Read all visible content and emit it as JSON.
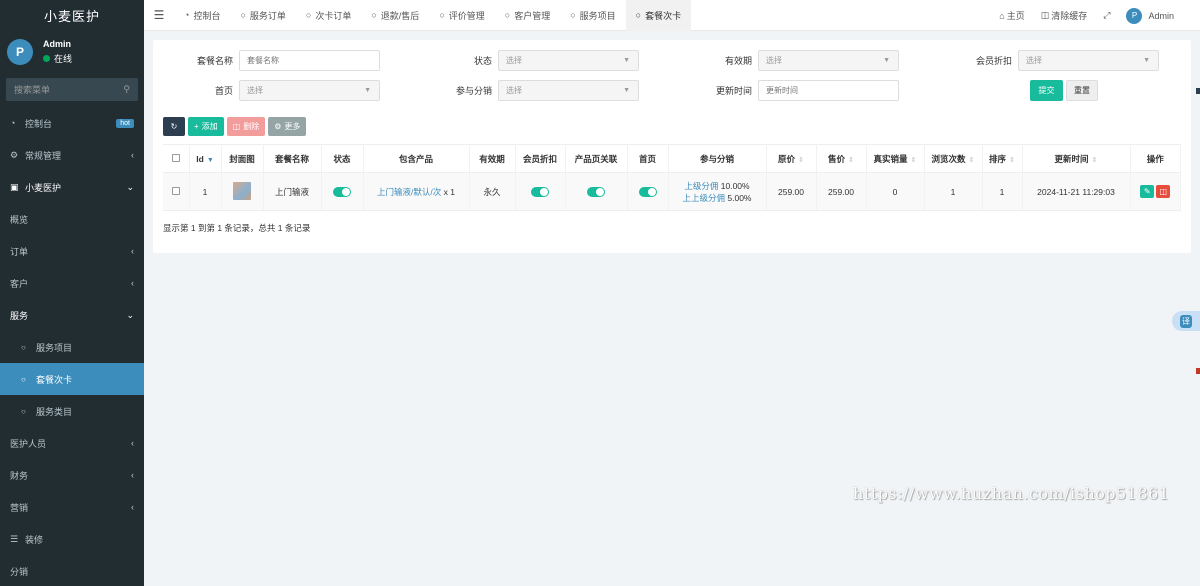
{
  "app": {
    "title": "小麦医护"
  },
  "user": {
    "name": "Admin",
    "status": "在线",
    "avatar_letter": "P"
  },
  "sidebar": {
    "search_placeholder": "搜索菜单",
    "items": [
      {
        "label": "控制台",
        "icon": "dashboard-icon",
        "badge": "hot"
      },
      {
        "label": "常规管理",
        "icon": "cogs-icon"
      },
      {
        "label": "小麦医护",
        "icon": "gamepad-icon",
        "open": true
      },
      {
        "label": "概览"
      },
      {
        "label": "订单"
      },
      {
        "label": "客户"
      },
      {
        "label": "服务",
        "open": true
      },
      {
        "label": "服务项目",
        "sub": true
      },
      {
        "label": "套餐次卡",
        "sub": true,
        "active": true
      },
      {
        "label": "服务类目",
        "sub": true
      },
      {
        "label": "医护人员"
      },
      {
        "label": "财务"
      },
      {
        "label": "营销"
      },
      {
        "label": "装修",
        "icon": "list-icon"
      },
      {
        "label": "分销"
      }
    ]
  },
  "header": {
    "tabs": [
      {
        "label": "控制台",
        "icon": "dashboard-icon"
      },
      {
        "label": "服务订单",
        "icon": "circle-icon"
      },
      {
        "label": "次卡订单",
        "icon": "circle-icon"
      },
      {
        "label": "退款/售后",
        "icon": "circle-icon"
      },
      {
        "label": "评价管理",
        "icon": "circle-icon"
      },
      {
        "label": "客户管理",
        "icon": "circle-icon"
      },
      {
        "label": "服务项目",
        "icon": "circle-icon"
      },
      {
        "label": "套餐次卡",
        "icon": "circle-icon",
        "active": true
      }
    ],
    "home": "主页",
    "clear_cache": "清除缓存",
    "admin": "Admin"
  },
  "filter": {
    "package_name_label": "套餐名称",
    "package_name_placeholder": "套餐名称",
    "status_label": "状态",
    "validity_label": "有效期",
    "member_discount_label": "会员折扣",
    "homepage_label": "首页",
    "distribution_label": "参与分销",
    "update_time_label": "更新时间",
    "update_time_placeholder": "更新时间",
    "select_placeholder": "选择",
    "submit": "提交",
    "reset": "重置"
  },
  "toolbar": {
    "add": "添加",
    "delete": "删除",
    "more": "更多"
  },
  "table": {
    "columns": [
      "Id",
      "封面图",
      "套餐名称",
      "状态",
      "包含产品",
      "有效期",
      "会员折扣",
      "产品页关联",
      "首页",
      "参与分销",
      "原价",
      "售价",
      "真实销量",
      "浏览次数",
      "排序",
      "更新时间",
      "操作"
    ],
    "rows": [
      {
        "id": "1",
        "name": "上门输液",
        "product_link": "上门输液/默认/次",
        "product_qty": "x 1",
        "validity": "永久",
        "commission1_label": "上级分佣",
        "commission1_value": "10.00%",
        "commission2_label": "上上级分佣",
        "commission2_value": "5.00%",
        "original_price": "259.00",
        "sale_price": "259.00",
        "real_sales": "0",
        "views": "1",
        "sort": "1",
        "updated": "2024-11-21 11:29:03"
      }
    ]
  },
  "pager": {
    "text": "显示第 1 到第 1 条记录，总共 1 条记录"
  },
  "watermark": {
    "text": "https://www.huzhan.com/ishop51861"
  },
  "widget": {
    "translate": "译"
  }
}
